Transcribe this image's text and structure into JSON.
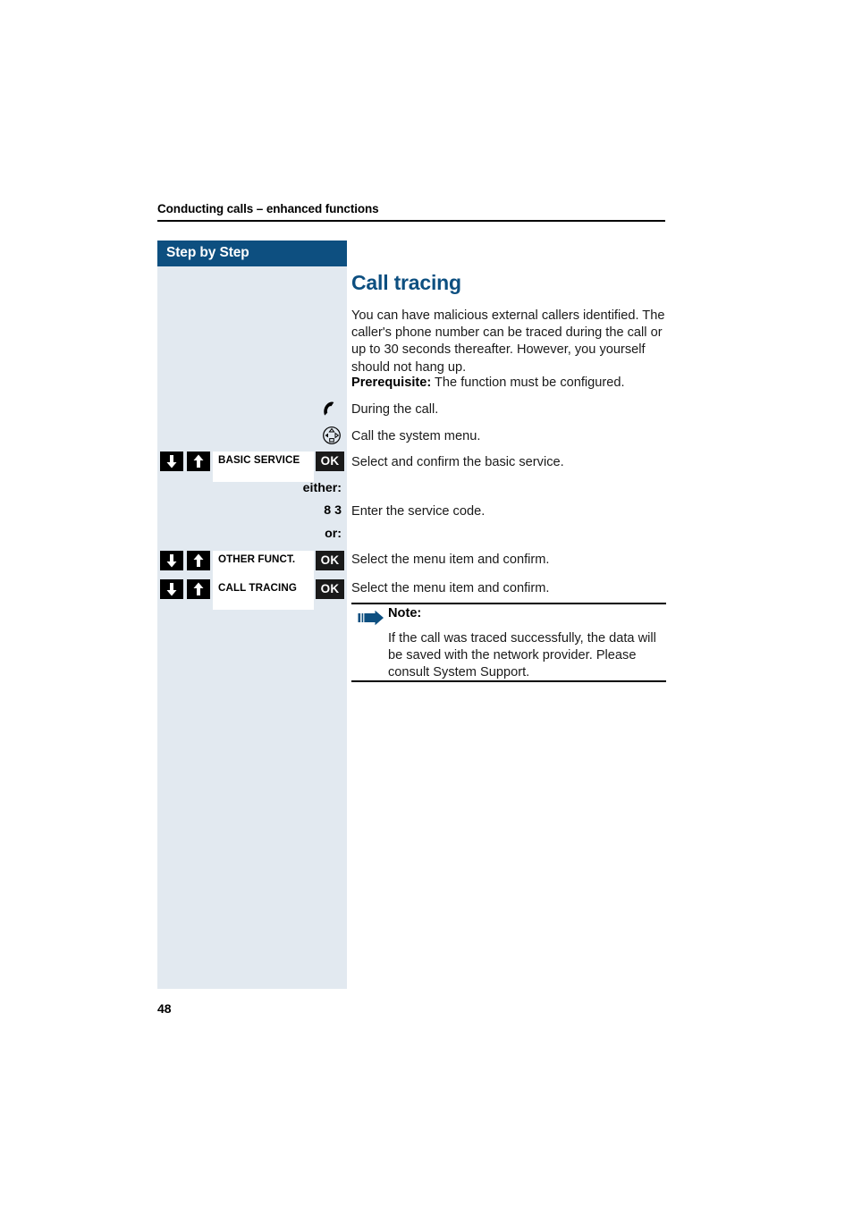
{
  "page": {
    "running_head": "Conducting calls – enhanced functions",
    "folio": "48",
    "accent_color": "#0d4f80",
    "sidebar_color": "#e2e9f0"
  },
  "sidebar": {
    "header_label": "Step by Step",
    "notes": {
      "either": "either:",
      "service_code": "8 3",
      "or": "or:"
    },
    "keys": [
      {
        "id": "basic-service",
        "down_icon": "arrow-down-icon",
        "up_icon": "arrow-up-icon",
        "label": "BASIC SERVICE",
        "confirm_label": "OK"
      },
      {
        "id": "other-funct",
        "down_icon": "arrow-down-icon",
        "up_icon": "arrow-up-icon",
        "label": "OTHER FUNCT.",
        "confirm_label": "OK"
      },
      {
        "id": "call-tracing",
        "down_icon": "arrow-down-icon",
        "up_icon": "arrow-up-icon",
        "label": "CALL TRACING",
        "confirm_label": "OK"
      }
    ]
  },
  "content": {
    "title": "Call tracing",
    "intro": "You can have malicious external callers identified. The caller's phone number can be traced during the call or up to 30 seconds thereafter. However, you yourself should not hang up.",
    "prerequisite_label": "Prerequisite:",
    "prerequisite_text": " The function must be configured.",
    "steps": [
      {
        "icon": "handset-icon",
        "text": "During the call."
      },
      {
        "icon": "navigator-icon",
        "text": "Call the system menu."
      },
      {
        "icon": "",
        "text": "Select and confirm the basic service."
      },
      {
        "icon": "",
        "text": "Enter the service code."
      },
      {
        "icon": "",
        "text": "Select the menu item and confirm."
      },
      {
        "icon": "",
        "text": "Select the menu item and confirm."
      }
    ],
    "note": {
      "icon": "note-arrow-icon",
      "title": "Note:",
      "body": "If the call was traced successfully, the data will be saved with the network provider. Please consult System Support."
    }
  }
}
